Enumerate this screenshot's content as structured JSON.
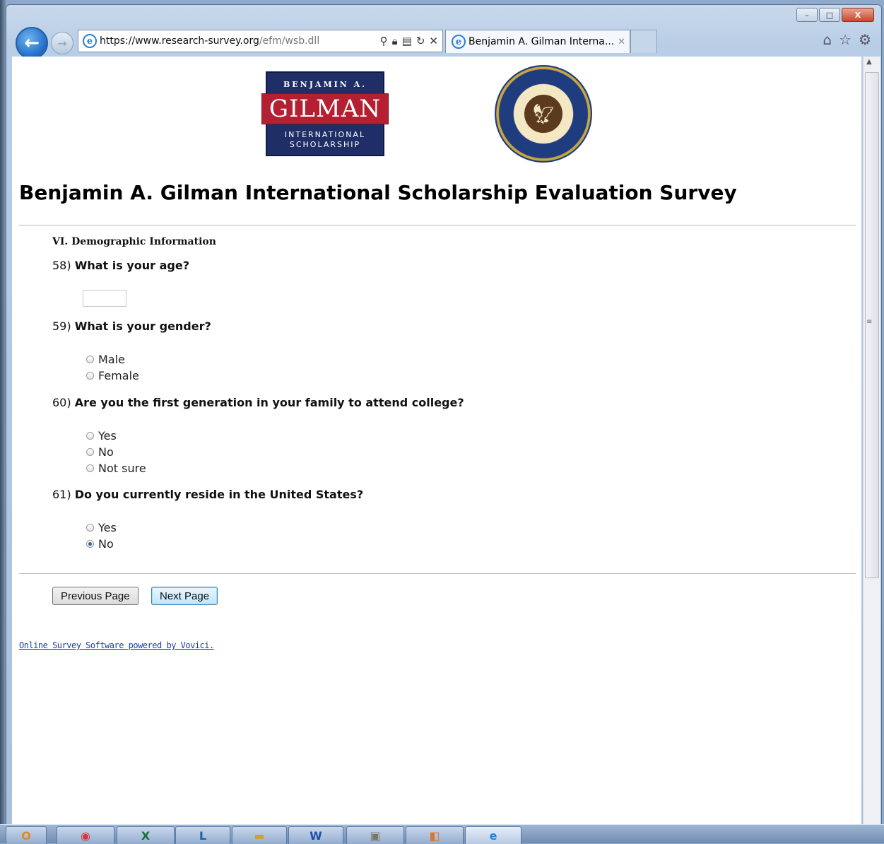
{
  "browser": {
    "url_host": "https://www.research-survey.org",
    "url_path": "/efm/wsb.dll",
    "tab_title": "Benjamin A. Gilman Interna...",
    "caption_buttons": [
      "–",
      "□",
      "X"
    ]
  },
  "logos": {
    "gilman_top": "BENJAMIN A.",
    "gilman_name": "GILMAN",
    "gilman_sub1": "INTERNATIONAL",
    "gilman_sub2": "SCHOLARSHIP"
  },
  "page": {
    "title": "Benjamin A. Gilman International Scholarship Evaluation Survey",
    "section": "VI. Demographic Information"
  },
  "questions": [
    {
      "number": "58)",
      "text": "What is your age?",
      "value": ""
    },
    {
      "number": "59)",
      "text": "What is your gender?",
      "options": [
        "Male",
        "Female"
      ],
      "selected": null
    },
    {
      "number": "60)",
      "text": "Are you the first generation in your family to attend college?",
      "options": [
        "Yes",
        "No",
        "Not sure"
      ],
      "selected": null
    },
    {
      "number": "61)",
      "text": "Do you currently reside in the United States?",
      "options": [
        "Yes",
        "No"
      ],
      "selected": "No"
    }
  ],
  "buttons": {
    "previous": "Previous Page",
    "next": "Next Page"
  },
  "footer": {
    "link": "Online Survey Software powered by Vovici."
  },
  "colors": {
    "gilman_navy": "#1f2e66",
    "gilman_red": "#b42032",
    "link": "#1a3fa8"
  },
  "taskbar": {
    "apps": [
      "outlook-icon",
      "chrome-icon",
      "excel-icon",
      "lync-icon",
      "explorer-icon",
      "word-icon",
      "notepad-icon",
      "outlook-reminder-icon",
      "ie-icon"
    ]
  }
}
